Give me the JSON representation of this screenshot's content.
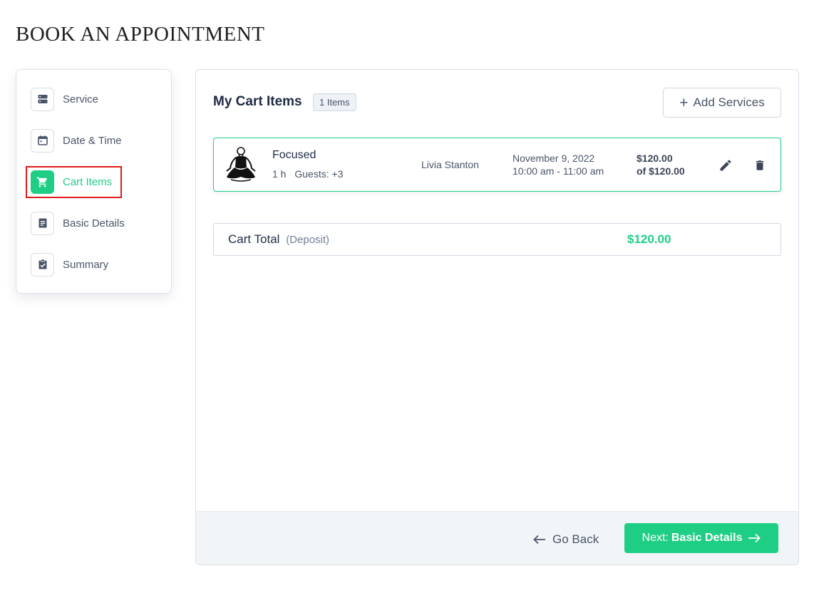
{
  "page": {
    "title": "BOOK AN APPOINTMENT"
  },
  "sidebar": {
    "steps": [
      {
        "label": "Service",
        "icon": "server-icon"
      },
      {
        "label": "Date & Time",
        "icon": "calendar-icon"
      },
      {
        "label": "Cart Items",
        "icon": "cart-icon",
        "active": true
      },
      {
        "label": "Basic Details",
        "icon": "document-icon"
      },
      {
        "label": "Summary",
        "icon": "clipboard-check-icon"
      }
    ]
  },
  "cart": {
    "title": "My Cart Items",
    "count_badge": "1 Items",
    "add_button": "Add Services",
    "items": [
      {
        "service": "Focused",
        "duration": "1 h",
        "guests": "Guests: +3",
        "staff": "Livia Stanton",
        "date": "November 9, 2022",
        "time": "10:00 am - 11:00 am",
        "price": "$120.00",
        "price_of": "of $120.00",
        "icon": "yoga-meditation-icon"
      }
    ],
    "total": {
      "label": "Cart Total",
      "sublabel": "(Deposit)",
      "value": "$120.00"
    }
  },
  "footer": {
    "back_label": "Go Back",
    "next_prefix": "Next:",
    "next_target": "Basic Details"
  },
  "colors": {
    "accent": "#1fce85",
    "highlight_border": "#e01b1b",
    "text_primary": "#1f2a44",
    "text_secondary": "#4a5568"
  }
}
